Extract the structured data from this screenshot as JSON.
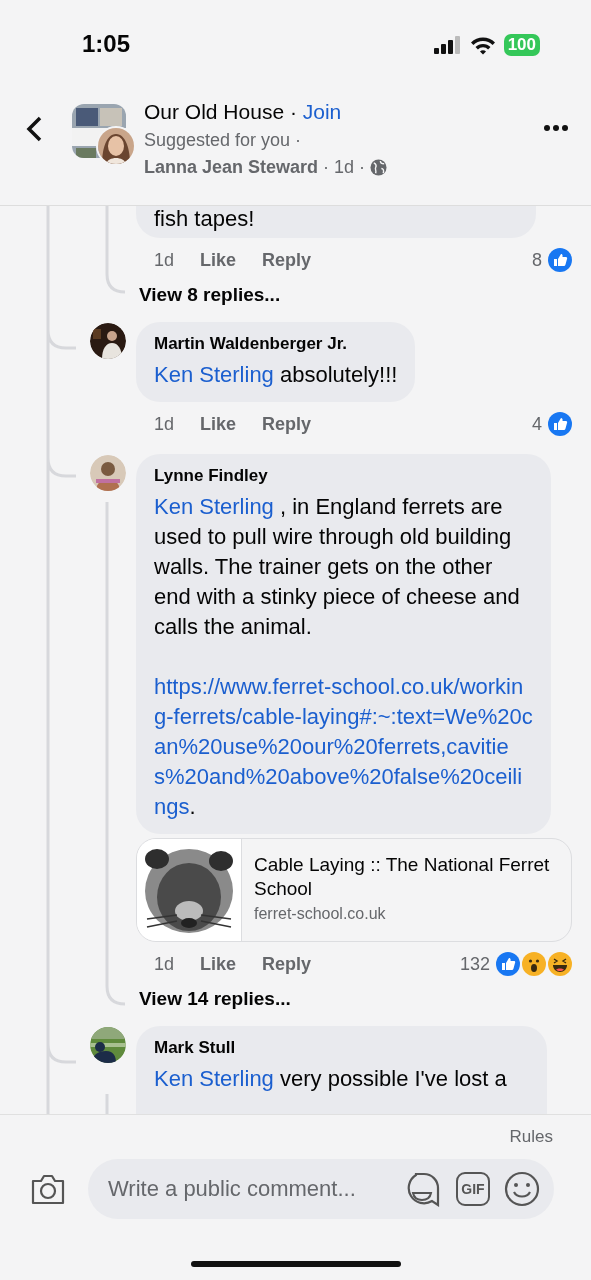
{
  "status_bar": {
    "time": "1:05",
    "battery": "100"
  },
  "header": {
    "group": "Our Old House",
    "separator": " · ",
    "join": "Join",
    "subtitle": "Suggested for you ·",
    "author": "Lanna Jean Steward",
    "meta": " · 1d · "
  },
  "comments": [
    {
      "kind": "partial",
      "paragraphs": [
        [
          {
            "kind": "text",
            "text": "fish tapes!"
          }
        ]
      ],
      "time": "1d",
      "like": "Like",
      "reply": "Reply",
      "reaction_count": "8",
      "reactions": [
        {
          "kind": "like"
        }
      ],
      "view_replies": "View 8 replies..."
    },
    {
      "kind": "full",
      "avatar": {
        "kind": "picture"
      },
      "author": "Martin Waldenberger Jr.",
      "paragraphs": [
        [
          {
            "kind": "mention",
            "text": "Ken Sterling"
          },
          {
            "kind": "text",
            "text": " absolutely!!!"
          }
        ]
      ],
      "time": "1d",
      "like": "Like",
      "reply": "Reply",
      "reaction_count": "4",
      "reactions": [
        {
          "kind": "like"
        }
      ]
    },
    {
      "kind": "full",
      "avatar": {
        "kind": "picture"
      },
      "author": "Lynne Findley",
      "paragraphs": [
        [
          {
            "kind": "mention",
            "text": "Ken Sterling"
          },
          {
            "kind": "text",
            "text": " , in England ferrets are used to pull wire through old building walls. The trainer gets on the other end with a stinky piece of cheese and calls the animal."
          }
        ],
        [
          {
            "kind": "url",
            "text": "https://www.ferret-school.co.uk/working-ferrets/cable-laying#:~:text=We%20can%20use%20our%20ferrets,cavities%20and%20above%20false%20ceilings"
          },
          {
            "kind": "text",
            "text": "."
          }
        ]
      ],
      "link_preview": {
        "title": "Cable Laying :: The National Ferret School",
        "domain": "ferret-school.co.uk",
        "kind": "picture"
      },
      "time": "1d",
      "like": "Like",
      "reply": "Reply",
      "reaction_count": "132",
      "reactions": [
        {
          "kind": "like"
        },
        {
          "kind": "wow"
        },
        {
          "kind": "haha"
        }
      ],
      "view_replies": "View 14 replies..."
    },
    {
      "kind": "cut",
      "avatar": {
        "kind": "picture"
      },
      "author": "Mark Stull",
      "paragraphs": [
        [
          {
            "kind": "mention",
            "text": "Ken Sterling"
          },
          {
            "kind": "text",
            "text": " very possible  I've lost a"
          }
        ]
      ]
    }
  ],
  "composer": {
    "rules": "Rules",
    "placeholder": "Write a public comment...",
    "gif_label": "GIF"
  }
}
